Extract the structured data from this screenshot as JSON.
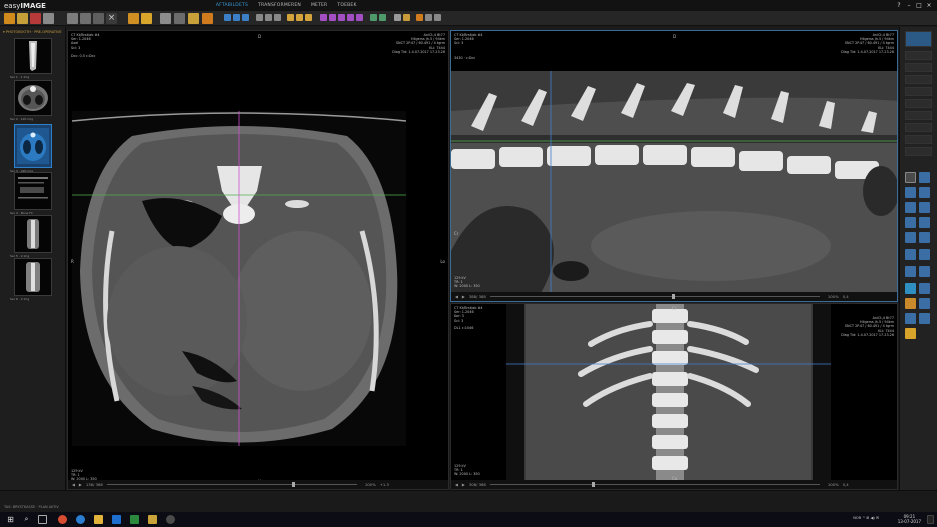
{
  "app": {
    "logo_prefix": "easy",
    "logo_suffix": "IMAGE",
    "menu": [
      "AFTABILDETS",
      "TRANSFORMEREN",
      "METER",
      "TOEBEK"
    ],
    "window_controls": [
      "?",
      "–",
      "□",
      "×"
    ]
  },
  "patient_header": "▾ PHOTOBOOTH · PRE-OPERATIVE DOG",
  "thumbnails": [
    {
      "caption": "Ser 1 · 1 img",
      "selected": false
    },
    {
      "caption": "Ser 2 · 120 img",
      "selected": false
    },
    {
      "caption": "Ser 3 · 220 img",
      "selected": true
    },
    {
      "caption": "Ser 4 · Bone Fil",
      "selected": false
    },
    {
      "caption": "Ser 5 · 2 img",
      "selected": false
    },
    {
      "caption": "Ser 6 · 2 img",
      "selected": false
    }
  ],
  "viewports": {
    "axial": {
      "tl": [
        "CT Kt/Brst/ab #4",
        "Ser: 1.2046",
        "Axel",
        "Sci: 3"
      ],
      "tl2": "Dcc: 0.5 c:Dcc",
      "tr": [
        "AniCt,4 Bt77",
        "Hilgerss Jh.5 / 94km",
        "SNCT 2P.47 / 60.491 / 4 tgrm",
        "KLI: T444",
        "Diag Tid: 1.4.07.2017 17.23.26"
      ],
      "top_marker": "D",
      "left_marker": "R",
      "right_marker": "Lo",
      "bottom_marker": "V",
      "bl": [
        "129 kV",
        "TR: 1",
        "W: 2000 L: 350"
      ],
      "bar": {
        "frame": "138/ 368",
        "zoom": "100%",
        "extra": "+1.3"
      }
    },
    "sagittal": {
      "tl": [
        "CT Kt/Brst/ab #4",
        "Ser: 1.2046",
        "Sci: 3"
      ],
      "tl2": "3430 · c:Dcc",
      "tr": [
        "AniCt,4 Bt77",
        "Hilgerss Jh.5 / 94km",
        "SNCT 2P.47 / 60.491 / 4 tgrm",
        "KLI: T444",
        "Diag Tid: 1.4.07.2017 17.23.26"
      ],
      "top_marker": "D",
      "left_marker": "Cr",
      "right_marker": "Ca",
      "bl": [
        "129 kV",
        "TR: 1",
        "W: 2000 L: 350"
      ],
      "bar": {
        "frame": "388/ 388",
        "zoom": "100%",
        "extra": "0,4"
      }
    },
    "coronal": {
      "tl": [
        "CT Kt/Brst/ab #4",
        "Ser: 1.2046",
        "Kor: 3",
        "Sci: 3"
      ],
      "tl2": "DL1 c:1046",
      "tr": [
        "AniCt,4 Bt77",
        "Hilgerss Jh.5 / 94km",
        "SNCT 2P.47 / 60.491 / 4 tgrm",
        "KLI: T444",
        "Diag Tid: 1.4.07.2017 17.23.26"
      ],
      "top_marker": "Cr",
      "bottom_marker": "Ca",
      "left_marker": "R",
      "right_marker": "L",
      "bl": [
        "129 kV",
        "TR: 1",
        "W: 2000 L: 350"
      ],
      "bar": {
        "frame": "308/ 368",
        "zoom": "100%",
        "extra": "0,4"
      }
    }
  },
  "status": {
    "text": "TAS: BRYSTKASSE · PLAN AKTIV"
  },
  "taskbar": {
    "tray": "NOR  ^ ⊞ ◀) ✉",
    "time": "09:21",
    "date": "13-07-2017"
  },
  "colors": {
    "accent": "#3b9bd9",
    "selected_thumb": "#19436e",
    "crosshair_green": "#4fb24f",
    "crosshair_blue": "#3f7fd0",
    "crosshair_magenta": "#d050d0"
  }
}
